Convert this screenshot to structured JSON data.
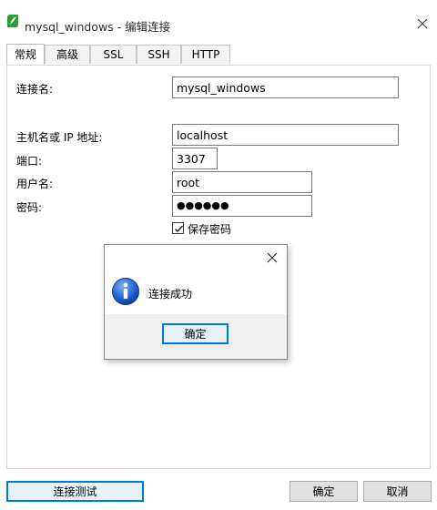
{
  "window": {
    "title": "mysql_windows - 编辑连接",
    "logo_color": "#2e9e3a"
  },
  "tabs": [
    {
      "label": "常规",
      "active": true
    },
    {
      "label": "高级",
      "active": false
    },
    {
      "label": "SSL",
      "active": false
    },
    {
      "label": "SSH",
      "active": false
    },
    {
      "label": "HTTP",
      "active": false
    }
  ],
  "form": {
    "connection_name_label": "连接名:",
    "connection_name_value": "mysql_windows",
    "host_label": "主机名或 IP 地址:",
    "host_value": "localhost",
    "port_label": "端口:",
    "port_value": "3307",
    "user_label": "用户名:",
    "user_value": "root",
    "password_label": "密码:",
    "password_value": "●●●●●●",
    "save_password_label": "保存密码",
    "save_password_checked": true
  },
  "buttons": {
    "test_connection": "连接测试",
    "ok": "确定",
    "cancel": "取消"
  },
  "dialog": {
    "message": "连接成功",
    "ok_label": "确定",
    "icon": "info-icon",
    "icon_color": "#1c58c8"
  },
  "colors": {
    "accent": "#0078d7",
    "button_face": "#e1e1e1"
  }
}
